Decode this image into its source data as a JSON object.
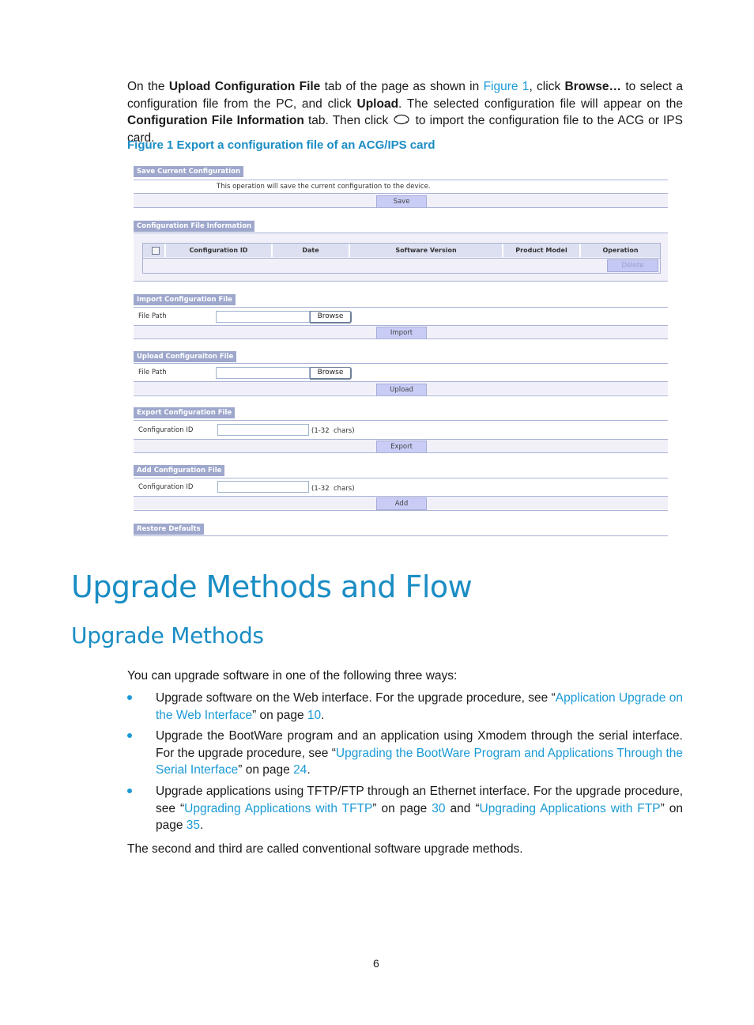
{
  "intro": {
    "t1": "On the ",
    "b1": "Upload Configuration File",
    "t2": " tab of the page as shown in ",
    "link_figure": "Figure 1",
    "t3": ", click ",
    "b2": "Browse…",
    "t4": " to select a configuration file from the PC, and click ",
    "b3": "Upload",
    "t5": ". The selected configuration file will appear on the ",
    "b4": "Configuration File Information",
    "t6": " tab. Then click ",
    "icon": "refresh-import-icon",
    "t7": " to import the configuration file to the ACG or IPS card."
  },
  "figure": {
    "caption": "Figure 1 Export a configuration file of an ACG/IPS card",
    "colors": {
      "tab_header": "#9ea7cc",
      "row_bg": "#f1f0f8",
      "button_bg": "#c9cdf6",
      "border": "#aab2d6"
    },
    "save_section": {
      "tab": "Save Current Configuration",
      "message": "This operation will save the current configuration to the device.",
      "button": "Save"
    },
    "info_section": {
      "tab": "Configuration File Information",
      "columns": [
        "Configuration ID",
        "Date",
        "Software Version",
        "Product Model",
        "Operation"
      ],
      "delete_button": "Delete"
    },
    "import_section": {
      "tab": "Import Configuration File",
      "label": "File Path",
      "input_value": "",
      "browse": "Browse",
      "button": "Import"
    },
    "upload_section": {
      "tab": "Upload Configuraiton File",
      "label": "File Path",
      "input_value": "",
      "browse": "Browse",
      "button": "Upload"
    },
    "export_section": {
      "tab": "Export Configuration File",
      "label": "Configuration ID",
      "input_value": "",
      "hint": "(1-32  chars)",
      "button": "Export"
    },
    "add_section": {
      "tab": "Add Configuration File",
      "label": "Configuration ID",
      "input_value": "",
      "hint": "(1-32  chars)",
      "button": "Add"
    },
    "restore_section": {
      "tab": "Restore Defaults"
    }
  },
  "heading1": "Upgrade Methods and Flow",
  "heading2": "Upgrade Methods",
  "lead": "You can upgrade software in one of the following three ways:",
  "bullets": [
    {
      "t1": "Upgrade software on the Web interface. For the upgrade procedure, see “",
      "l1": "Application Upgrade on the Web Interface",
      "t2": "” on page ",
      "p1": "10",
      "t3": "."
    },
    {
      "t1": "Upgrade the BootWare program and an application using Xmodem through the serial interface. For the upgrade procedure, see “",
      "l1": "Upgrading the BootWare Program and Applications Through the Serial Interface",
      "t2": "” on page ",
      "p1": "24",
      "t3": "."
    },
    {
      "t1": "Upgrade applications using TFTP/FTP through an Ethernet interface. For the upgrade procedure, see “",
      "l1": "Upgrading Applications with TFTP",
      "t2": "” on page ",
      "p1": "30",
      "t3": " and “",
      "l2": "Upgrading Applications with FTP",
      "t4": "” on page ",
      "p2": "35",
      "t5": "."
    }
  ],
  "closing": "The second and third are called conventional software upgrade methods.",
  "page_number": "6"
}
